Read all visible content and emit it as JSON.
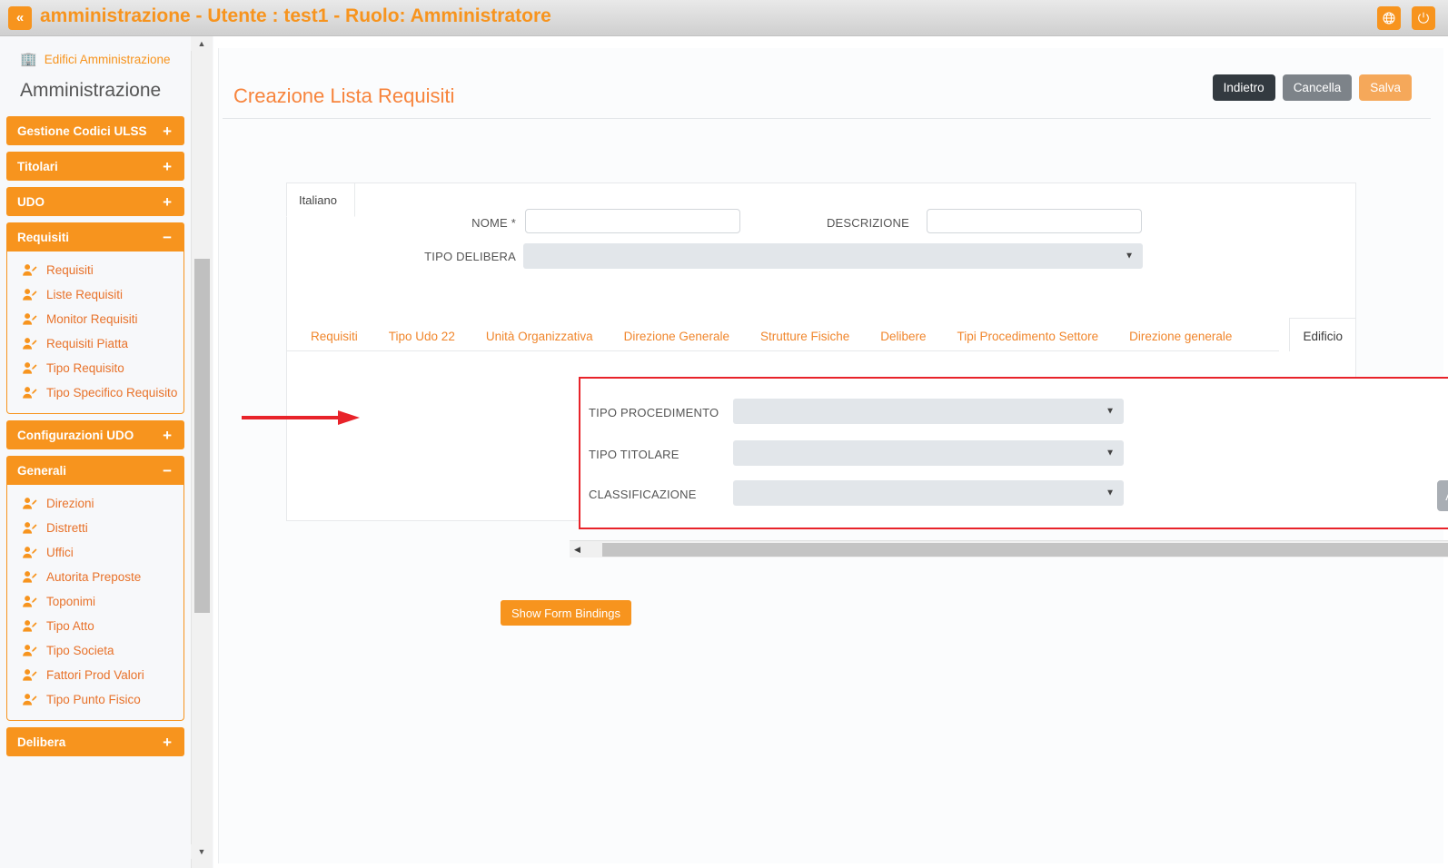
{
  "topbar": {
    "collapse_icon": "double-chevron-left-icon",
    "title": "amministrazione - Utente : test1 - Ruolo: Amministratore",
    "globe_icon": "globe-icon",
    "power_icon": "power-icon",
    "accent_color": "#f7941e"
  },
  "sidebar": {
    "top_link": {
      "icon": "building-icon",
      "label": "Edifici Amministrazione"
    },
    "heading": "Amministrazione",
    "groups": [
      {
        "label": "Gestione Codici ULSS",
        "toggle": "+",
        "expanded": false,
        "items": []
      },
      {
        "label": "Titolari",
        "toggle": "+",
        "expanded": false,
        "items": []
      },
      {
        "label": "UDO",
        "toggle": "+",
        "expanded": false,
        "items": []
      },
      {
        "label": "Requisiti",
        "toggle": "−",
        "expanded": true,
        "items": [
          "Requisiti",
          "Liste Requisiti",
          "Monitor Requisiti",
          "Requisiti Piatta",
          "Tipo Requisito",
          "Tipo Specifico Requisito"
        ]
      },
      {
        "label": "Configurazioni UDO",
        "toggle": "+",
        "expanded": false,
        "items": []
      },
      {
        "label": "Generali",
        "toggle": "−",
        "expanded": true,
        "items": [
          "Direzioni",
          "Distretti",
          "Uffici",
          "Autorita Preposte",
          "Toponimi",
          "Tipo Atto",
          "Tipo Societa",
          "Fattori Prod Valori",
          "Tipo Punto Fisico"
        ]
      },
      {
        "label": "Delibera",
        "toggle": "+",
        "expanded": false,
        "items": []
      }
    ],
    "scroll_up_icon": "triangle-up-icon",
    "scroll_down_icon": "triangle-down-icon"
  },
  "main": {
    "page_title": "Creazione Lista Requisiti",
    "header_buttons": [
      {
        "label": "Indietro",
        "color": "#333a40"
      },
      {
        "label": "Cancella",
        "color": "#7d8389"
      },
      {
        "label": "Salva",
        "color": "#f5a85a"
      }
    ],
    "language_tab": "Italiano",
    "fields": {
      "nome": {
        "label": "NOME *",
        "value": "",
        "placeholder": ""
      },
      "descrizione": {
        "label": "DESCRIZIONE",
        "value": "",
        "placeholder": ""
      },
      "tipo_delibera": {
        "label": "TIPO DELIBERA",
        "value": "",
        "caret": "▼"
      }
    },
    "tabs": [
      "Requisiti",
      "Tipo Udo 22",
      "Unità Organizzativa",
      "Direzione Generale",
      "Strutture Fisiche",
      "Delibere",
      "Tipi Procedimento Settore",
      "Direzione generale"
    ],
    "active_tab": "Edificio",
    "panel_fields": {
      "tipo_procedimento": {
        "label": "TIPO PROCEDIMENTO",
        "value": "",
        "caret": "▼"
      },
      "tipo_titolare": {
        "label": "TIPO TITOLARE",
        "value": "",
        "caret": "▼"
      },
      "classificazione": {
        "label": "CLASSIFICAZIONE",
        "value": "",
        "caret": "▼"
      }
    },
    "add_button": "Aggiungi",
    "bindings_button": "Show Form Bindings",
    "hscroll": {
      "left_icon": "◀",
      "right_icon": "▶"
    },
    "highlight_color": "#e8232a",
    "annotation_arrow": "red-arrow-pointing-right"
  }
}
